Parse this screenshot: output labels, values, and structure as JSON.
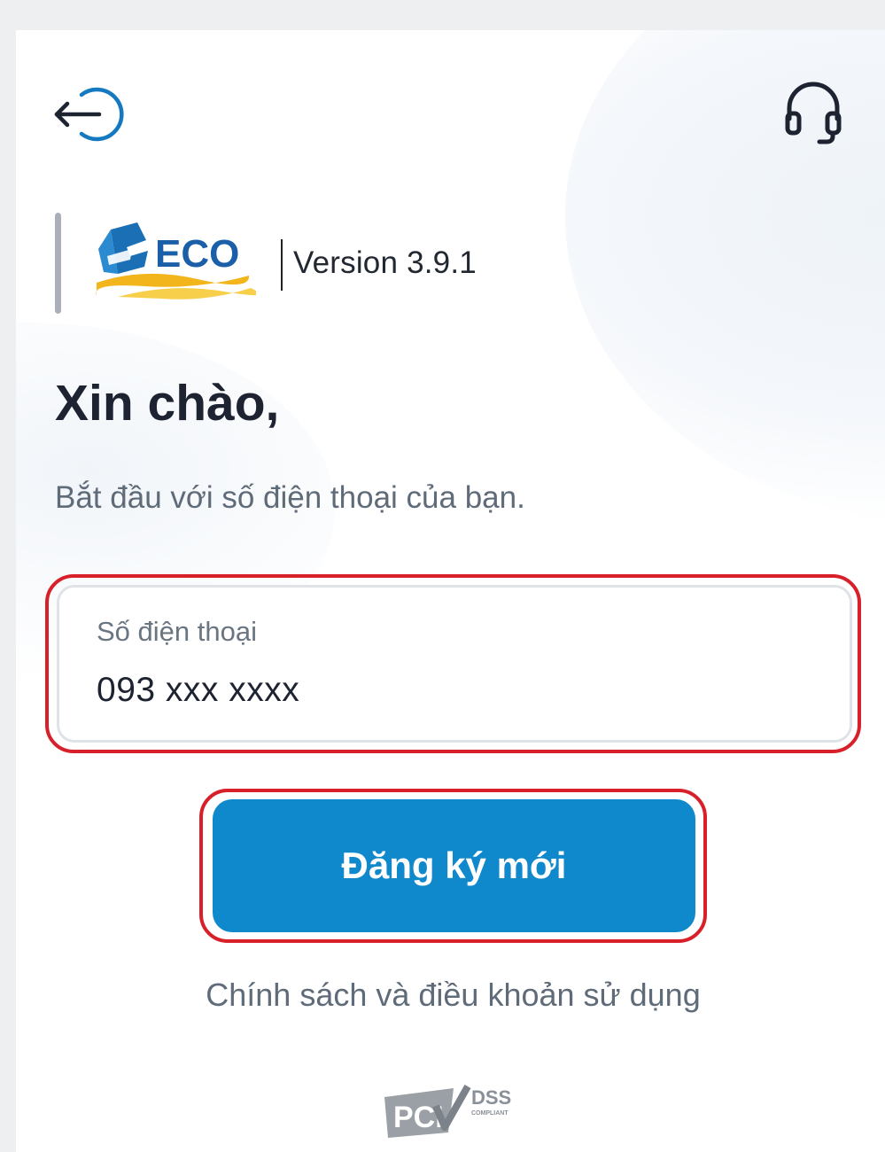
{
  "header": {
    "back_icon": "logout-arrow-icon",
    "support_icon": "headset-icon"
  },
  "brand": {
    "logo_text": "ECO",
    "version": "Version 3.9.1"
  },
  "main": {
    "greeting": "Xin chào,",
    "subtitle": "Bắt đầu với số điện thoại của bạn.",
    "phone_field": {
      "label": "Số điện thoại",
      "value": "093 xxx xxxx"
    },
    "register_label": "Đăng ký mới",
    "policy_link": "Chính sách và điều khoản sử dụng"
  },
  "footer": {
    "badge_main": "PCI",
    "badge_dss": "DSS",
    "badge_compliant": "COMPLIANT"
  },
  "colors": {
    "primary": "#0f88cc",
    "highlight_outline": "#d8202a",
    "heading": "#1d2330",
    "muted": "#5f6b78"
  }
}
